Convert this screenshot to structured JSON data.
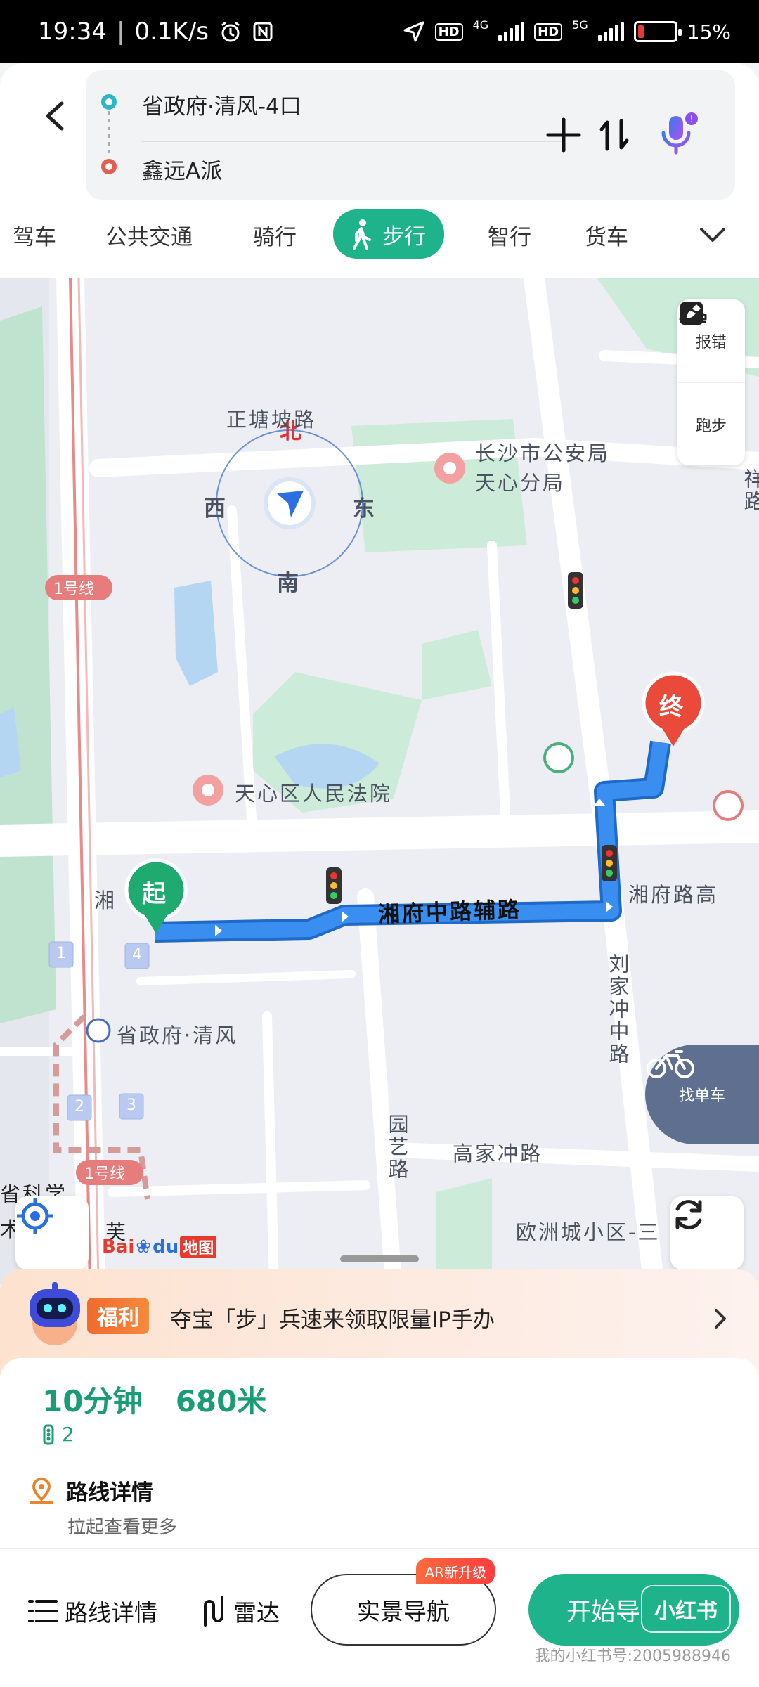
{
  "status_bar": {
    "time": "19:34",
    "net_speed": "0.1K/s",
    "net1": "4G",
    "net2": "5G",
    "hd": "HD",
    "battery": "15%",
    "battery_level": 0.15
  },
  "header": {
    "origin": "省政府·清风-4口",
    "destination": "鑫远A派",
    "origin_color": "#2bb6c9",
    "destination_color": "#ea5b4f"
  },
  "modes": {
    "items": [
      "驾车",
      "公共交通",
      "骑行",
      "步行",
      "智行",
      "货车"
    ],
    "active": "步行",
    "active_color": "#1fb38b"
  },
  "map": {
    "labels": {
      "road_top": "正塘坡路",
      "police": "长沙市公安局",
      "police2": "天心分局",
      "court": "天心区人民法院",
      "road_main": "湘府中路辅路",
      "road_right": "湘府路高",
      "road_left": "湘",
      "station": "省政府·清风",
      "road_vert": "刘家冲中路",
      "road_vert2": "园艺路",
      "road_bottom": "高家冲路",
      "district": "欧洲城小区-三",
      "school": "省科学",
      "school2": "术",
      "line1a": "1号线",
      "line1b": "1号线",
      "road_right2": "祥路",
      "fu": "芙",
      "exit1": "1",
      "exit2": "2",
      "exit3": "3",
      "exit4": "4"
    },
    "compass": {
      "north": "北",
      "south": "南",
      "east": "东",
      "west": "西"
    },
    "start_marker": "起",
    "end_marker": "终",
    "route_color": "#3a8ef0",
    "side_buttons": [
      "报错",
      "跑步"
    ],
    "bike_label": "找单车",
    "logo": {
      "bai": "Bai",
      "du": "du",
      "tail": "地图"
    }
  },
  "promo": {
    "tag": "福利",
    "text": "夺宝「步」兵速来领取限量IP手办"
  },
  "route_card": {
    "time": "10分钟",
    "distance": "680米",
    "traffic_lights": "2",
    "detail_title": "路线详情",
    "detail_hint": "拉起查看更多"
  },
  "bottom_bar": {
    "details": "路线详情",
    "radar": "雷达",
    "ar_nav": "实景导航",
    "ar_badge": "AR新升级",
    "start": "开始导航",
    "xhs": "小红书"
  },
  "watermark": "我的小红书号:2005988946"
}
